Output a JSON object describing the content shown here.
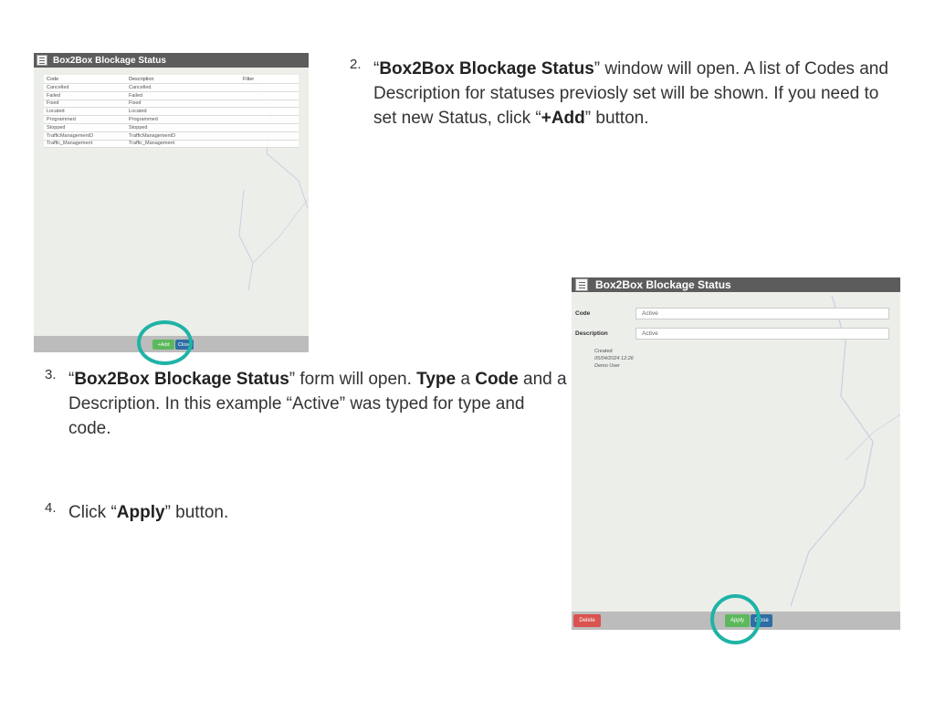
{
  "panel_list": {
    "title": "Box2Box Blockage Status",
    "columns": [
      "Code",
      "Description",
      "Filter"
    ],
    "rows": [
      [
        "Cancelled",
        "Cancelled"
      ],
      [
        "Failed",
        "Failed"
      ],
      [
        "Fixed",
        "Fixed"
      ],
      [
        "Located",
        "Located"
      ],
      [
        "Programmed",
        "Programmed"
      ],
      [
        "Stopped",
        "Stopped"
      ],
      [
        "TrafficManagementD",
        "TrafficManagementD"
      ],
      [
        "Traffic_Management",
        "Traffic_Management"
      ]
    ],
    "add_label": "+Add",
    "close_label": "Close"
  },
  "panel_form": {
    "title": "Box2Box Blockage Status",
    "code_label": "Code",
    "code_value": "Active",
    "description_label": "Description",
    "description_value": "Active",
    "created_label": "Created",
    "created_date": "05/04/2024 12:26",
    "created_user": "Demo User",
    "delete_label": "Delete",
    "apply_label": "Apply",
    "close_label": "Close"
  },
  "steps": {
    "s2": {
      "num": "2.",
      "q1": "“",
      "b1": "Box2Box Blockage Status",
      "t1": "” window will open. A list of Codes and Description for statuses previosly set will be shown. If you need to set new Status, click “",
      "b2": "+Add",
      "t2": "” button."
    },
    "s3": {
      "num": "3.",
      "q1": "“",
      "b1": "Box2Box Blockage Status",
      "t1": "” form will open. ",
      "b2": "Type",
      "t2": " a ",
      "b3": "Code",
      "t3": " and a Description. In this example “Active” was typed for type and code."
    },
    "s4": {
      "num": "4.",
      "t1": "Click “",
      "b1": "Apply",
      "t2": "” button."
    }
  },
  "colors": {
    "ring": "#1fb3a6",
    "titlebar": "#5c5c5c",
    "apply_green": "#5cb85c",
    "close_blue": "#2e6da4",
    "delete_red": "#d9534f"
  }
}
